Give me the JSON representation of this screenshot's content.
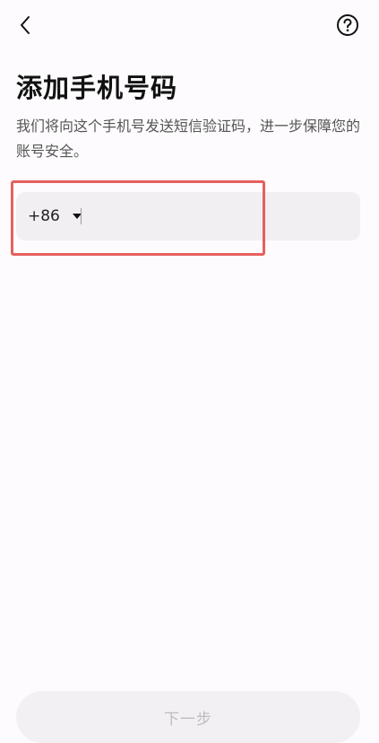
{
  "header": {
    "back_icon": "chevron-left-icon",
    "help_icon": "question-circle-icon"
  },
  "page": {
    "title": "添加手机号码",
    "subtitle": "我们将向这个手机号发送短信验证码，进一步保障您的账号安全。"
  },
  "phone": {
    "country_code": "+86",
    "value": "",
    "placeholder": ""
  },
  "footer": {
    "next_label": "下一步"
  },
  "colors": {
    "background": "#fdfbfd",
    "field_background": "#f1eff2",
    "highlight": "#e5605e",
    "button_disabled_text": "#bdbdbd"
  }
}
